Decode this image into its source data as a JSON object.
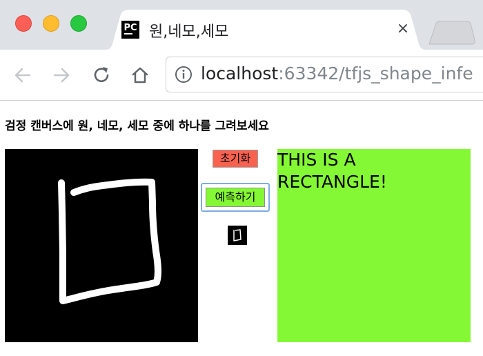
{
  "browser": {
    "tab": {
      "favicon_text": "PC",
      "title": "원,네모,세모",
      "close_glyph": "×"
    },
    "url": {
      "host": "localhost",
      "rest": ":63342/tfjs_shape_infe"
    },
    "icons": {
      "back": "back-arrow-icon",
      "forward": "forward-arrow-icon",
      "reload": "reload-icon",
      "home": "home-icon",
      "info": "info-icon"
    }
  },
  "page": {
    "heading": "검정 캔버스에 원, 네모, 세모 중에 하나를 그려보세요",
    "reset_label": "초기화",
    "predict_label": "예측하기",
    "result_text": "THIS IS A RECTANGLE!"
  },
  "colors": {
    "reset_button": "#fa6250",
    "predict_button": "#85f835",
    "result_background": "#85f835",
    "canvas": "#000000",
    "stroke": "#ffffff"
  }
}
